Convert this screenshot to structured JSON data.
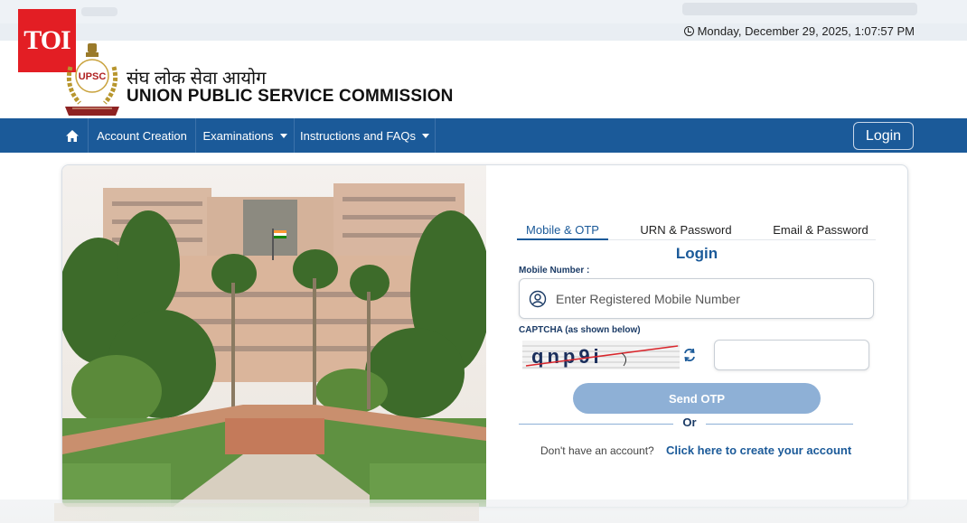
{
  "header": {
    "datetime": "Monday, December 29, 2025, 1:07:57 PM",
    "toi_logo": "TOI",
    "emblem_text": "UPSC",
    "org_name_hindi": "संघ लोक सेवा आयोग",
    "org_name_english": "UNION PUBLIC SERVICE COMMISSION"
  },
  "nav": {
    "home_icon": "home-icon",
    "items": [
      {
        "label": "Account Creation"
      },
      {
        "label": "Examinations",
        "has_dropdown": true
      },
      {
        "label": "Instructions and FAQs",
        "has_dropdown": true
      }
    ],
    "login_label": "Login"
  },
  "login_panel": {
    "tabs": [
      {
        "label": "Mobile & OTP",
        "active": true
      },
      {
        "label": "URN & Password",
        "active": false
      },
      {
        "label": "Email & Password",
        "active": false
      }
    ],
    "title": "Login",
    "mobile_label": "Mobile Number :",
    "mobile_placeholder": "Enter Registered Mobile Number",
    "captcha_label": "CAPTCHA (as shown below)",
    "captcha_text": "qnp9i",
    "captcha_input_value": "",
    "send_otp_label": "Send OTP",
    "or_label": "Or",
    "no_account_text": "Don't have an account?",
    "create_account_link": "Click here to create your account"
  },
  "colors": {
    "nav_blue": "#1b5a99",
    "button_disabled": "#8eb0d6",
    "toi_red": "#e31e24"
  }
}
